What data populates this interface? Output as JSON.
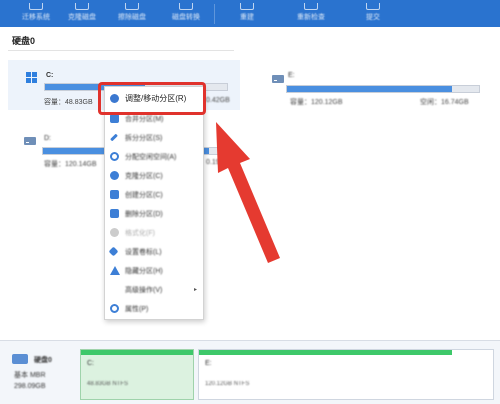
{
  "toolbar": {
    "items": [
      {
        "label": "迁移系统",
        "icon": "migrate-icon"
      },
      {
        "label": "克隆磁盘",
        "icon": "clone-icon"
      },
      {
        "label": "擦除磁盘",
        "icon": "wipe-icon"
      },
      {
        "label": "磁盘转换",
        "icon": "convert-icon"
      },
      {
        "label": "重建",
        "icon": "rebuild-icon"
      },
      {
        "label": "重新检查",
        "icon": "recheck-icon"
      },
      {
        "label": "提交",
        "icon": "commit-icon"
      }
    ]
  },
  "disk0": {
    "title": "硬盘0",
    "partitions": [
      {
        "name": "C:",
        "capacity_label": "容量：48.83GB",
        "free_label": "0.42GB",
        "usage": 0.55
      },
      {
        "name": "E:",
        "capacity_label": "容量：120.12GB",
        "free_label": "空闲：16.74GB",
        "usage": 0.86
      },
      {
        "name": "D:",
        "capacity_label": "容量：120.14GB",
        "free_label": "0.19GB",
        "usage": 0.9
      }
    ]
  },
  "context_menu": {
    "items": [
      {
        "label": "调整/移动分区(R)",
        "icon": "resize-move-icon",
        "enabled": true
      },
      {
        "label": "合并分区(M)",
        "icon": "merge-icon",
        "enabled": true
      },
      {
        "label": "拆分分区(S)",
        "icon": "split-icon",
        "enabled": true
      },
      {
        "label": "分配空闲空间(A)",
        "icon": "allocate-icon",
        "enabled": true
      },
      {
        "label": "克隆分区(C)",
        "icon": "clone-partition-icon",
        "enabled": true
      },
      {
        "label": "创建分区(C)",
        "icon": "create-icon",
        "enabled": true
      },
      {
        "label": "删除分区(D)",
        "icon": "delete-icon",
        "enabled": true
      },
      {
        "label": "格式化(F)",
        "icon": "format-icon",
        "enabled": false
      },
      {
        "label": "设置卷标(L)",
        "icon": "label-icon",
        "enabled": true
      },
      {
        "label": "隐藏分区(H)",
        "icon": "hide-icon",
        "enabled": true
      },
      {
        "label": "高级操作(V)",
        "icon": "advanced-icon",
        "enabled": true,
        "submenu": true
      },
      {
        "label": "属性(P)",
        "icon": "properties-icon",
        "enabled": true
      }
    ]
  },
  "disk_map": {
    "disk_label": "硬盘0",
    "disk_type": "基本 MBR",
    "disk_size": "298.09GB",
    "segments": [
      {
        "name": "C:",
        "size": "48.83GB NTFS",
        "fill": 1.0
      },
      {
        "name": "E:",
        "size": "120.12GB NTFS",
        "fill": 0.86
      }
    ]
  },
  "colors": {
    "accent": "#2a73cf",
    "highlight": "#e0322c",
    "bar": "#4a8fe0",
    "used_green": "#3ec86a"
  }
}
